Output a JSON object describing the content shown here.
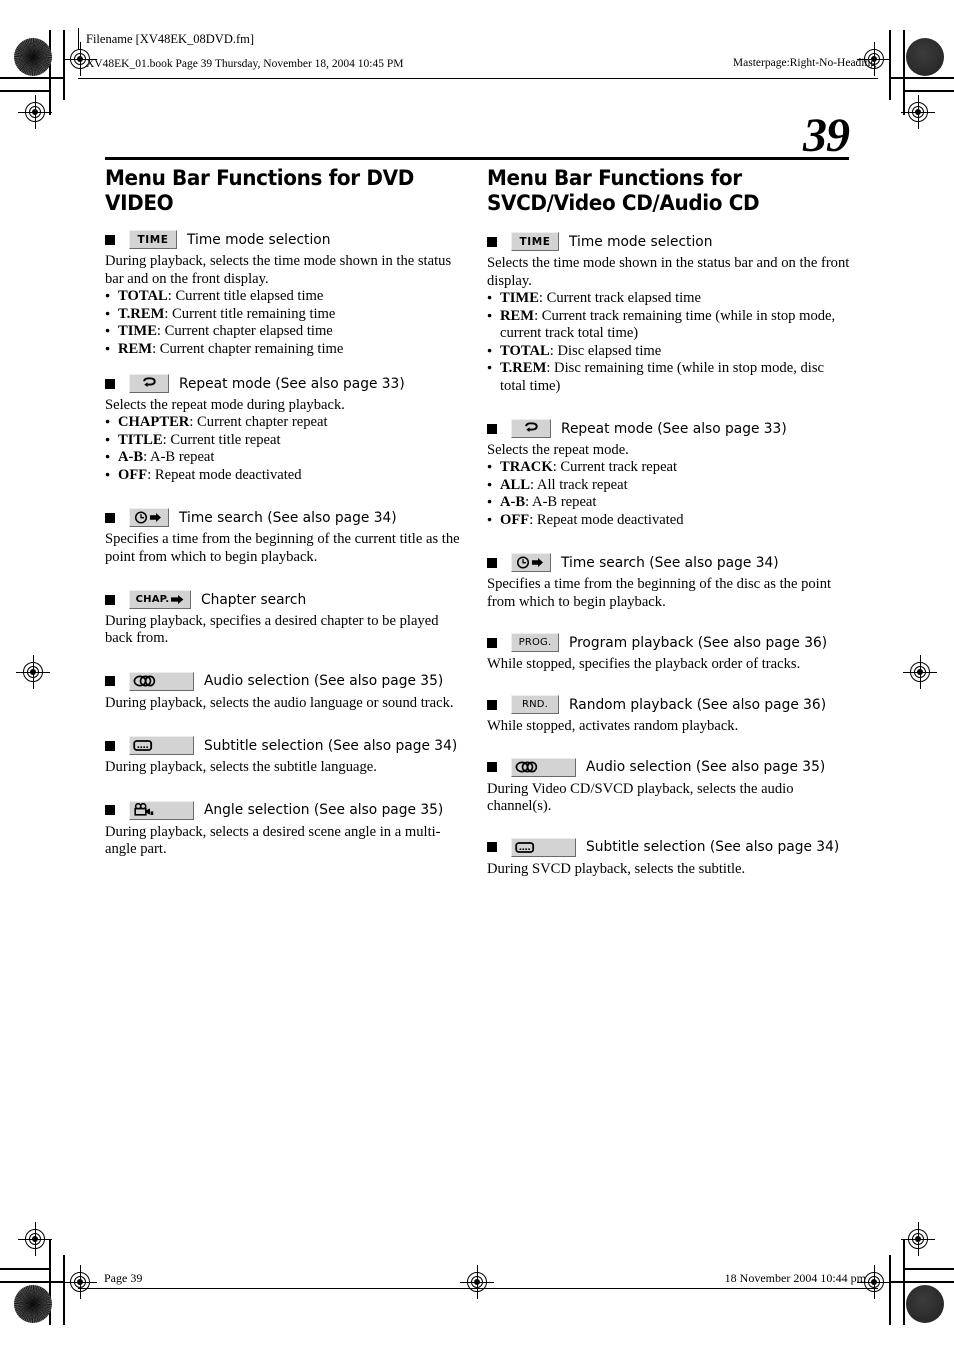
{
  "header": {
    "filename": "Filename [XV48EK_08DVD.fm]",
    "bookline": "XV48EK_01.book  Page 39  Thursday, November 18, 2004  10:45 PM",
    "masterpage": "Masterpage:Right-No-Heading"
  },
  "page_number": "39",
  "footer": {
    "left": "Page 39",
    "right": "18 November 2004 10:44 pm"
  },
  "left_column": {
    "heading": "Menu Bar Functions for DVD VIDEO",
    "items": [
      {
        "icon": "time-button",
        "button_text": "TIME",
        "label": "Time mode selection",
        "desc": "During playback, selects the time mode shown in the status bar and on the front display.",
        "bullets": [
          {
            "term": "TOTAL",
            "text": ": Current title elapsed time"
          },
          {
            "term": "T.REM",
            "text": ": Current title remaining time"
          },
          {
            "term": "TIME",
            "text": ": Current chapter elapsed time"
          },
          {
            "term": "REM",
            "text": ": Current chapter remaining time"
          }
        ]
      },
      {
        "icon": "repeat-loop-icon",
        "button_text": "",
        "label": "Repeat mode (See also page 33)",
        "desc": "Selects the repeat mode during playback.",
        "bullets": [
          {
            "term": "CHAPTER",
            "text": ": Current chapter repeat"
          },
          {
            "term": "TITLE",
            "text": ": Current title repeat"
          },
          {
            "term": "A-B",
            "text": ": A-B repeat"
          },
          {
            "term": "OFF",
            "text": ": Repeat mode deactivated"
          }
        ]
      },
      {
        "icon": "clock-arrow-icon",
        "button_text": "",
        "label": "Time search (See also page 34)",
        "desc": "Specifies a time from the beginning of the current title as the point from which to begin playback.",
        "bullets": []
      },
      {
        "icon": "chapter-arrow-button",
        "button_text": "CHAP.",
        "label": "Chapter search",
        "desc": "During playback, specifies a desired chapter to be played back from.",
        "bullets": []
      },
      {
        "icon": "audio-stereo-icon",
        "button_text": "",
        "label": "Audio selection (See also page 35)",
        "desc": "During playback, selects the audio language or sound track.",
        "bullets": []
      },
      {
        "icon": "subtitle-icon",
        "button_text": "",
        "label": "Subtitle selection (See also page 34)",
        "desc": "During playback, selects the subtitle language.",
        "bullets": []
      },
      {
        "icon": "movie-camera-angle-icon",
        "button_text": "",
        "label": "Angle selection (See also page 35)",
        "desc": "During playback, selects a desired scene angle in a multi-angle part.",
        "bullets": []
      }
    ]
  },
  "right_column": {
    "heading": "Menu Bar Functions for SVCD/Video CD/Audio CD",
    "items": [
      {
        "icon": "time-button",
        "button_text": "TIME",
        "label": "Time mode selection",
        "desc": "Selects the time mode shown in the status bar and on the front display.",
        "bullets": [
          {
            "term": "TIME",
            "text": ": Current track elapsed time"
          },
          {
            "term": "REM",
            "text": ": Current track remaining time (while in stop mode, current track total time)"
          },
          {
            "term": "TOTAL",
            "text": ": Disc elapsed time"
          },
          {
            "term": "T.REM",
            "text": ": Disc remaining time (while in stop mode, disc total time)"
          }
        ]
      },
      {
        "icon": "repeat-loop-icon",
        "button_text": "",
        "label": "Repeat mode (See also page 33)",
        "desc": "Selects the repeat mode.",
        "bullets": [
          {
            "term": "TRACK",
            "text": ": Current track repeat"
          },
          {
            "term": "ALL",
            "text": ": All track repeat"
          },
          {
            "term": "A-B",
            "text": ": A-B repeat"
          },
          {
            "term": "OFF",
            "text": ": Repeat mode deactivated"
          }
        ]
      },
      {
        "icon": "clock-arrow-icon",
        "button_text": "",
        "label": "Time search (See also page 34)",
        "desc": "Specifies a time from the beginning of the disc as the point from which to begin playback.",
        "bullets": []
      },
      {
        "icon": "program-button",
        "button_text": "PROG.",
        "label": "Program playback (See also page 36)",
        "desc": "While stopped, specifies the playback order of tracks.",
        "bullets": []
      },
      {
        "icon": "random-button",
        "button_text": "RND.",
        "label": "Random playback (See also page 36)",
        "desc": "While stopped, activates random playback.",
        "bullets": []
      },
      {
        "icon": "audio-stereo-icon",
        "button_text": "",
        "label": "Audio selection (See also page 35)",
        "desc": "During Video CD/SVCD playback, selects the audio channel(s).",
        "bullets": []
      },
      {
        "icon": "subtitle-icon",
        "button_text": "",
        "label": "Subtitle selection (See also page 34)",
        "desc": "During SVCD playback, selects the subtitle.",
        "bullets": []
      }
    ]
  }
}
